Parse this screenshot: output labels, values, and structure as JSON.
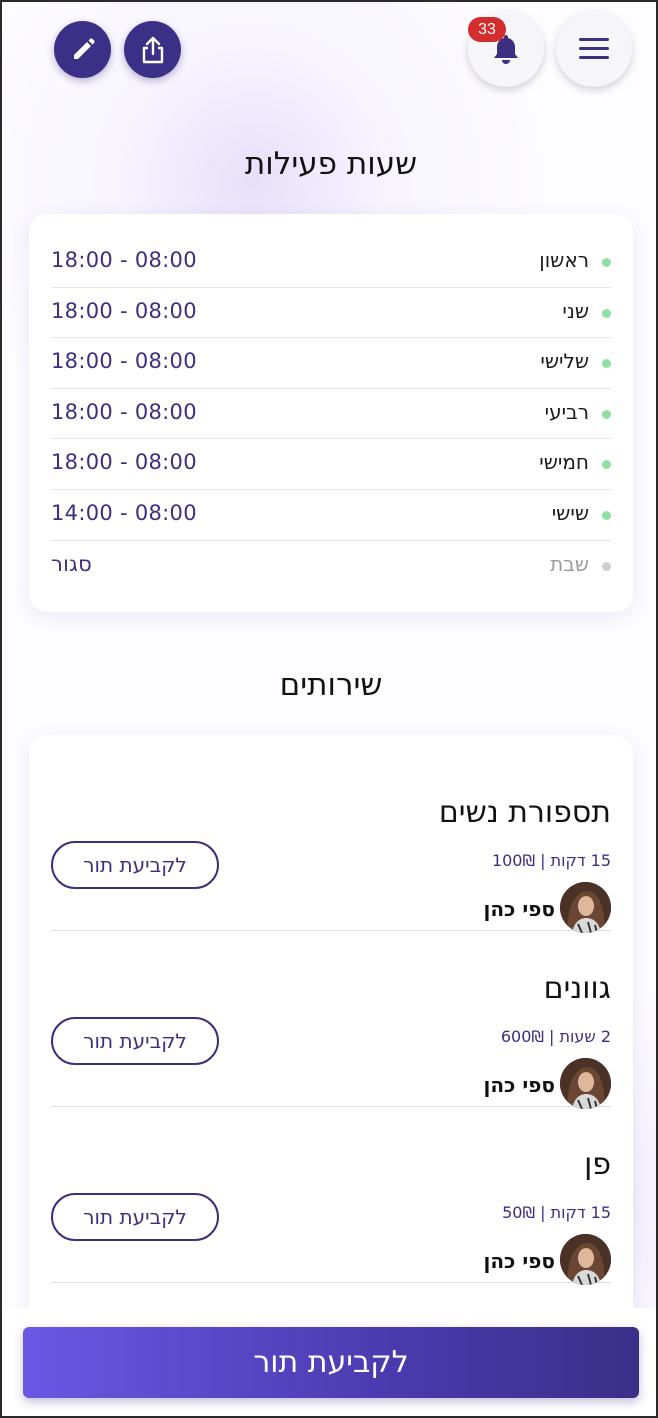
{
  "header": {
    "notification_count": "33",
    "icons": [
      "menu-icon",
      "bell-icon",
      "share-icon",
      "edit-icon"
    ]
  },
  "hours": {
    "title": "שעות פעילות",
    "days": [
      {
        "name": "ראשון",
        "hours": "18:00 - 08:00",
        "open": true
      },
      {
        "name": "שני",
        "hours": "18:00 - 08:00",
        "open": true
      },
      {
        "name": "שלישי",
        "hours": "18:00 - 08:00",
        "open": true
      },
      {
        "name": "רביעי",
        "hours": "18:00 - 08:00",
        "open": true
      },
      {
        "name": "חמישי",
        "hours": "18:00 - 08:00",
        "open": true
      },
      {
        "name": "שישי",
        "hours": "14:00 - 08:00",
        "open": true
      },
      {
        "name": "שבת",
        "hours": "סגור",
        "open": false
      }
    ]
  },
  "services": {
    "title": "שירותים",
    "items": [
      {
        "name": "תספורת נשים",
        "meta": "15 דקות | 100₪",
        "staff": "ספי כהן",
        "button": "לקביעת תור"
      },
      {
        "name": "גוונים",
        "meta": "2 שעות | 600₪",
        "staff": "ספי כהן",
        "button": "לקביעת תור"
      },
      {
        "name": "פן",
        "meta": "15 דקות | 50₪",
        "staff": "ספי כהן",
        "button": "לקביעת תור"
      }
    ]
  },
  "cta": {
    "label": "לקביעת תור"
  },
  "colors": {
    "primary": "#3c2f88",
    "accent_gradient_start": "#6a58e4",
    "open_dot": "#8fe0a4",
    "closed_dot": "#cfcfcf",
    "badge": "#d42d2d"
  }
}
